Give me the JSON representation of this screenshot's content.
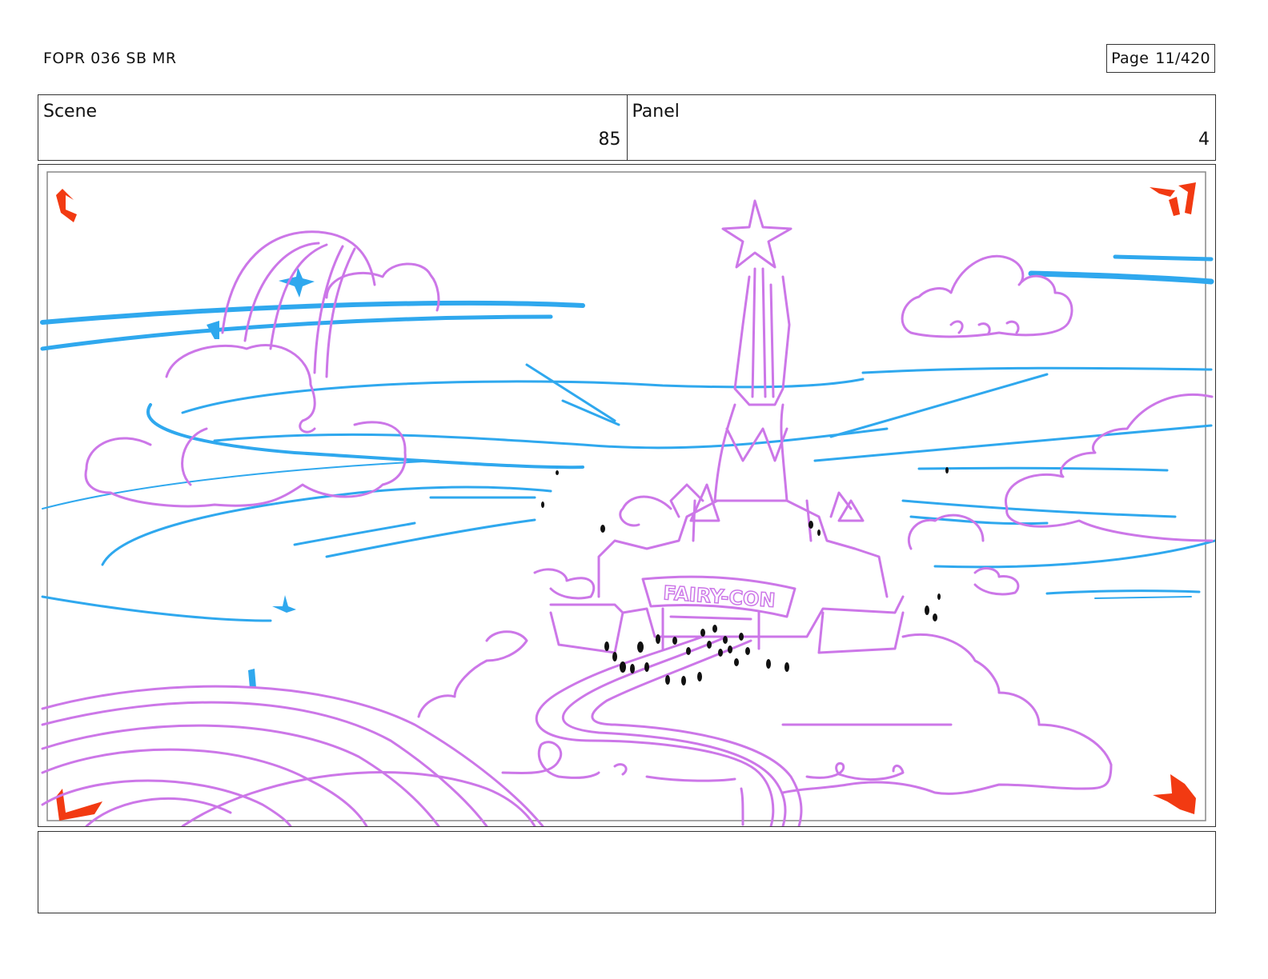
{
  "header": {
    "doc_title": "FOPR 036 SB MR",
    "page_label": "Page",
    "page_value": "11/420"
  },
  "info": {
    "scene_label": "Scene",
    "scene_value": "85",
    "panel_label": "Panel",
    "panel_value": "4"
  },
  "panel": {
    "sign_text": "FAIRY-CON",
    "colors": {
      "sketch_purple": "#cc77e8",
      "sky_blue": "#2fa8ee",
      "corner_red": "#f23a12",
      "crowd_black": "#111111"
    },
    "icons": [
      "corner-marker-top-left-icon",
      "corner-marker-top-right-icon",
      "corner-marker-bottom-left-icon",
      "corner-marker-bottom-right-icon"
    ]
  },
  "notes": {
    "text": ""
  }
}
